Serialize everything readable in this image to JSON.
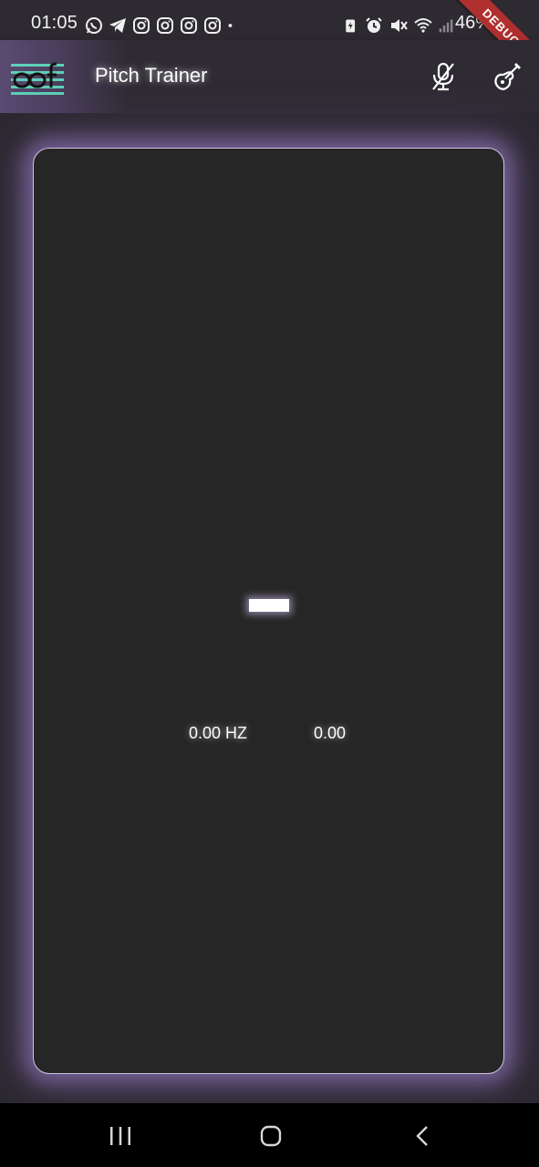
{
  "status_bar": {
    "time": "01:05",
    "battery": "46%",
    "left_icons": [
      "whatsapp-icon",
      "telegram-icon",
      "instagram-icon",
      "instagram-icon",
      "instagram-icon",
      "instagram-icon",
      "dot-icon"
    ],
    "right_icons": [
      "battery-saver-icon",
      "alarm-icon",
      "mute-icon",
      "wifi-icon",
      "signal-icon"
    ]
  },
  "debug_banner": "DEBUG",
  "app_bar": {
    "title": "Pitch Trainer",
    "logo_icon": "staff-logo-icon",
    "actions": [
      "mic-off-icon",
      "guitar-icon"
    ]
  },
  "tuner": {
    "frequency": "0.00 HZ",
    "cents": "0.00"
  },
  "nav_bar": {
    "buttons": [
      "recents-icon",
      "home-icon",
      "back-icon"
    ]
  },
  "colors": {
    "background": "#2b282f",
    "card": "#262626",
    "glow": "#a082cd",
    "debug_ribbon": "#b0302f",
    "logo_accent": "#5fd0b8"
  }
}
